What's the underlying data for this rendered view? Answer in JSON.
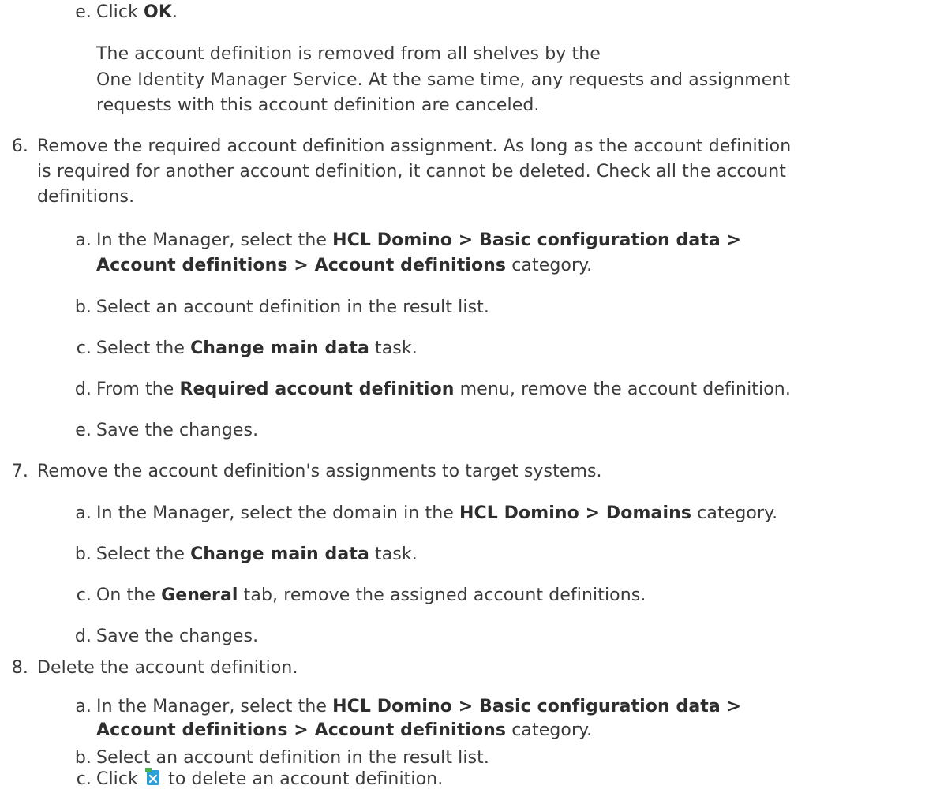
{
  "step5": {
    "e": {
      "marker": "e.",
      "pre": "Click ",
      "bold": "OK",
      "post": "."
    },
    "note": {
      "line1": "The account definition is removed from all shelves by the",
      "line2": "One Identity Manager Service. At the same time, any requests and assignment",
      "line3": "requests with this account definition are canceled."
    }
  },
  "step6": {
    "marker": "6.",
    "line1": "Remove the required account definition assignment. As long as the account definition",
    "line2": "is required for another account definition, it cannot be deleted. Check all the account",
    "line3": "definitions.",
    "a": {
      "marker": "a.",
      "pre": "In the Manager, select the ",
      "bold1": "HCL Domino > Basic configuration data >",
      "bold2": "Account definitions > Account definitions",
      "post": " category."
    },
    "b": {
      "marker": "b.",
      "text": "Select an account definition in the result list."
    },
    "c": {
      "marker": "c.",
      "pre": "Select the ",
      "bold": "Change main data",
      "post": " task."
    },
    "d": {
      "marker": "d.",
      "pre": "From the ",
      "bold": "Required account definition",
      "post": " menu, remove the account definition."
    },
    "e": {
      "marker": "e.",
      "text": "Save the changes."
    }
  },
  "step7": {
    "marker": "7.",
    "text": "Remove the account definition's assignments to target systems.",
    "a": {
      "marker": "a.",
      "pre": "In the Manager, select the domain in the ",
      "bold": "HCL Domino > Domains",
      "post": " category."
    },
    "b": {
      "marker": "b.",
      "pre": "Select the ",
      "bold": "Change main data",
      "post": " task."
    },
    "c": {
      "marker": "c.",
      "pre": "On the ",
      "bold": "General",
      "post": " tab, remove the assigned account definitions."
    },
    "d": {
      "marker": "d.",
      "text": "Save the changes."
    }
  },
  "step8": {
    "marker": "8.",
    "text": "Delete the account definition.",
    "a": {
      "marker": "a.",
      "pre": "In the Manager, select the ",
      "bold1": "HCL Domino > Basic configuration data >",
      "bold2": "Account definitions > Account definitions",
      "post": " category."
    },
    "b": {
      "marker": "b.",
      "text": "Select an account definition in the result list."
    },
    "c": {
      "marker": "c.",
      "pre": "Click ",
      "icon": "delete-icon",
      "post": " to delete an account definition."
    }
  },
  "colors": {
    "text": "#3b3b3b",
    "icon_blue": "#2a9fd8",
    "icon_green": "#4caf50"
  }
}
